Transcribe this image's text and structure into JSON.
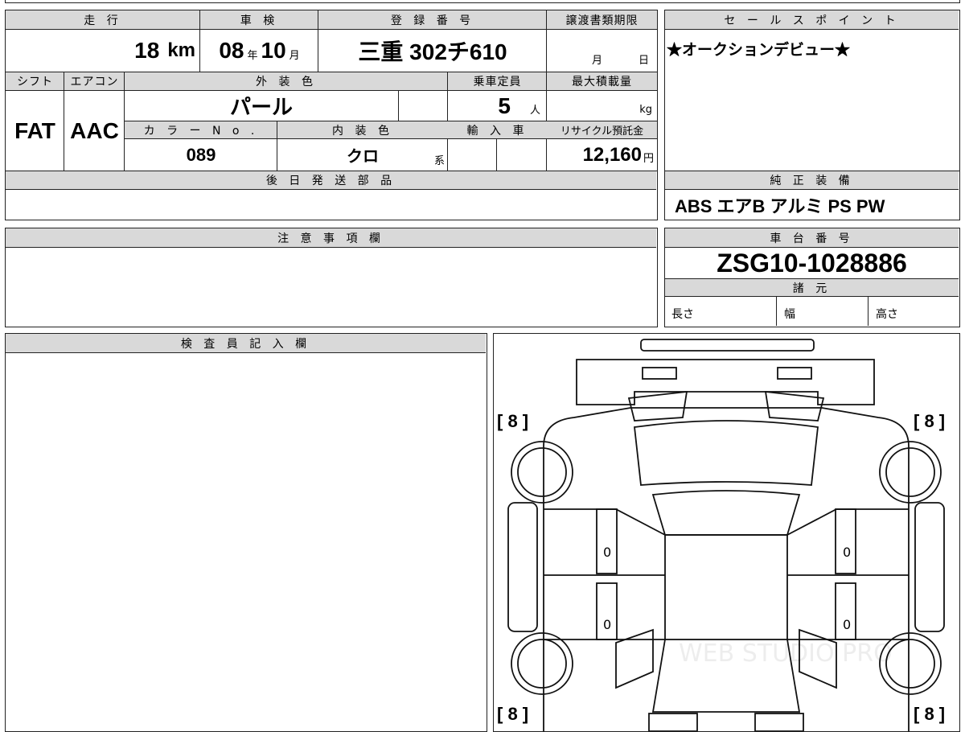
{
  "top_row": {
    "mileage_header": "走 行",
    "inspection_header": "車 検",
    "registration_header": "登 録 番 号",
    "transfer_deadline_header": "譲渡書類期限",
    "mileage_value": "18",
    "mileage_unit": "km",
    "inspection_year": "08",
    "inspection_year_unit": "年",
    "inspection_month": "10",
    "inspection_month_unit": "月",
    "registration_value": "三重 302チ610",
    "deadline_month_unit": "月",
    "deadline_day_unit": "日"
  },
  "second_row": {
    "shift_header": "シフト",
    "aircon_header": "エアコン",
    "exterior_color_header": "外 装 色",
    "capacity_header": "乗車定員",
    "max_load_header": "最大積載量",
    "shift_value": "FAT",
    "aircon_value": "AAC",
    "exterior_color_value": "パール",
    "capacity_value": "5",
    "capacity_unit": "人",
    "max_load_unit": "kg",
    "color_no_header": "カ ラ ー N o .",
    "interior_color_header": "内 装 色",
    "import_header": "輸 入 車",
    "recycle_header": "リサイクル預託金",
    "color_no_value": "089",
    "interior_color_value": "クロ",
    "interior_color_suffix": "系",
    "recycle_value": "12,160",
    "recycle_unit": "円"
  },
  "later_parts": {
    "header": "後 日 発 送 部 品"
  },
  "sales_point": {
    "header": "セ ー ル ス ポ イ ン ト",
    "text": "★オークションデビュー★"
  },
  "equipment": {
    "header": "純 正 装 備",
    "text": "ABS エアB アルミ PS PW"
  },
  "notes": {
    "header": "注 意 事 項 欄"
  },
  "chassis": {
    "header": "車 台 番 号",
    "value": "ZSG10-1028886"
  },
  "specs": {
    "header": "諸 元",
    "length_label": "長さ",
    "width_label": "幅",
    "height_label": "高さ"
  },
  "inspector": {
    "header": "検 査 員 記 入 欄"
  },
  "diagram": {
    "tire_tl": "[ 8 ]",
    "tire_tr": "[ 8 ]",
    "tire_bl": "[ 8 ]",
    "tire_br": "[ 8 ]",
    "door_fl": "0",
    "door_fr": "0",
    "door_rl": "0",
    "door_rr": "0",
    "watermark": "WEB STUDIO PRO"
  }
}
